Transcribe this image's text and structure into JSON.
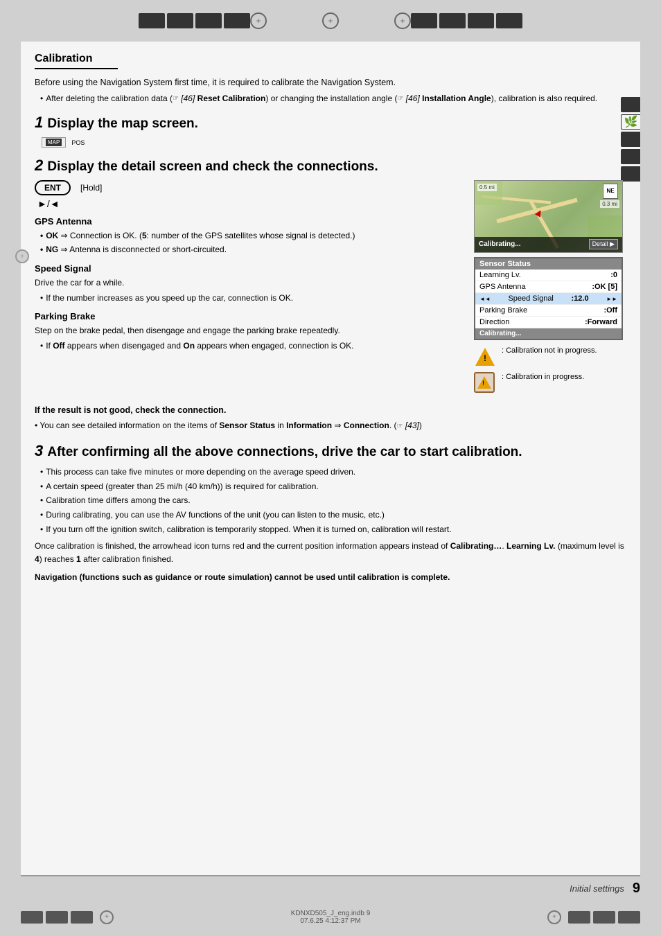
{
  "page": {
    "title": "Calibration",
    "section": "Initial settings",
    "page_number": "9"
  },
  "intro": {
    "text1": "Before using the Navigation System first time, it is required to calibrate the Navigation System.",
    "bullet1": "After deleting the calibration data (",
    "bullet1_ref": "☞ [46]",
    "bullet1_bold": "Reset Calibration",
    "bullet1_mid": ") or changing the installation",
    "bullet1_angle": "angle (",
    "bullet1_angle_ref": "☞ [46]",
    "bullet1_angle_bold": "Installation Angle",
    "bullet1_end": "), calibration is also required."
  },
  "step1": {
    "number": "1",
    "heading": "Display the map screen.",
    "map_button": "MAP",
    "pos_label": "POS"
  },
  "step2": {
    "number": "2",
    "heading": "Display the detail screen and check the connections.",
    "ent_label": "ENT",
    "hold_label": "[Hold]",
    "arrow_keys": "►/◄",
    "gps_antenna": {
      "heading": "GPS Antenna",
      "ok_bullet": "OK ⇒ Connection is OK. ([5]: number of the GPS satellites whose signal is detected.)",
      "ng_bullet": "NG ⇒ Antenna is disconnected or short-circuited."
    },
    "speed_signal": {
      "heading": "Speed Signal",
      "text": "Drive the car for a while.",
      "bullet": "If the number increases as you speed up the car, connection is OK."
    },
    "parking_brake": {
      "heading": "Parking Brake",
      "text": "Step on the brake pedal, then disengage and engage the parking brake repeatedly.",
      "bullet": "If Off appears when disengaged and On appears when engaged, connection is OK."
    }
  },
  "result_note": "If the result is not good, check the connection.",
  "connection_ref": "You can see detailed information on the items of Sensor Status in Information ⇒ Connection. (☞ [43])",
  "map_display": {
    "calibrating_label": "Calibrating...",
    "detail_label": "Detail"
  },
  "sensor_status": {
    "title": "Sensor Status",
    "rows": [
      {
        "label": "Learning Lv.",
        "value": ":0",
        "arrows": false,
        "highlighted": false
      },
      {
        "label": "GPS Antenna",
        "value": ":OK [5]",
        "arrows": false,
        "highlighted": false
      },
      {
        "label": "Speed Signal",
        "value": ":12.0",
        "arrows": true,
        "highlighted": true
      },
      {
        "label": "Parking Brake",
        "value": ":Off",
        "arrows": false,
        "highlighted": false
      },
      {
        "label": "Direction",
        "value": ":Forward",
        "arrows": false,
        "highlighted": false
      }
    ],
    "calibrating_label": "Calibrating..."
  },
  "calib_legend": {
    "item1_text": ": Calibration not in progress.",
    "item2_text": ": Calibration in progress."
  },
  "step3": {
    "number": "3",
    "heading": "After confirming all the above connections, drive the car to start calibration.",
    "bullets": [
      "This process can take five minutes or more depending on the average speed driven.",
      "A certain speed (greater than 25 mi/h (40 km/h)) is required for calibration.",
      "Calibration time differs among the cars.",
      "During calibrating, you can use the AV functions of the unit (you can listen to the music, etc.)",
      "If you turn off the ignition switch, calibration is temporarily stopped. When it is turned on, calibration will restart."
    ]
  },
  "bottom_notes": {
    "note1": "Once calibration is finished, the arrowhead icon turns red and the current position information appears instead of Calibrating…. Learning Lv. (maximum level is 4) reaches 1 after calibration finished.",
    "note2": "Navigation (functions such as guidance or route simulation) cannot be used until calibration is complete."
  },
  "footer": {
    "section_label": "Initial settings",
    "page_number": "9",
    "filename": "KDNXD505_J_eng.indb  9",
    "timestamp": "07.6.25  4:12:37 PM"
  }
}
